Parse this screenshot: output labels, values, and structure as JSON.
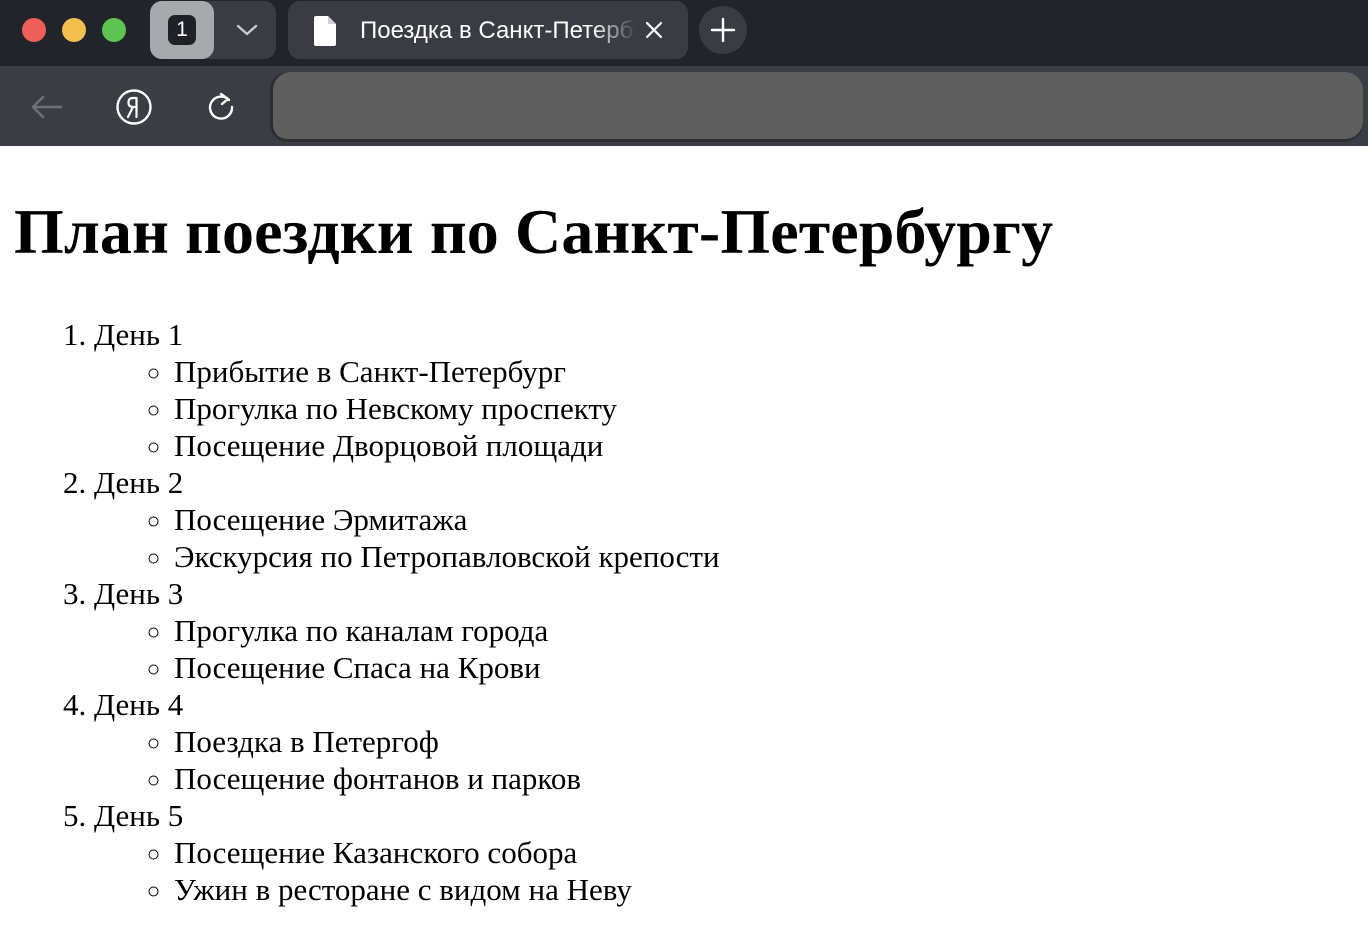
{
  "browser": {
    "tab_count": "1",
    "tab_title": "Поездка в Санкт-Петербург",
    "address": ""
  },
  "page": {
    "heading": "План поездки по Санкт-Петербургу",
    "days": [
      {
        "label": "День 1",
        "activities": [
          "Прибытие в Санкт-Петербург",
          "Прогулка по Невскому проспекту",
          "Посещение Дворцовой площади"
        ]
      },
      {
        "label": "День 2",
        "activities": [
          "Посещение Эрмитажа",
          "Экскурсия по Петропавловской крепости"
        ]
      },
      {
        "label": "День 3",
        "activities": [
          "Прогулка по каналам города",
          "Посещение Спаса на Крови"
        ]
      },
      {
        "label": "День 4",
        "activities": [
          "Поездка в Петергоф",
          "Посещение фонтанов и парков"
        ]
      },
      {
        "label": "День 5",
        "activities": [
          "Посещение Казанского собора",
          "Ужин в ресторане с видом на Неву"
        ]
      }
    ]
  },
  "icons": {
    "window_close": "traffic-light-red",
    "window_minimize": "traffic-light-yellow",
    "window_zoom": "traffic-light-green",
    "tabs_dropdown": "chevron-down-icon",
    "tab_document": "document-icon",
    "tab_close": "close-icon",
    "new_tab": "plus-icon",
    "back": "arrow-left-icon",
    "yandex": "yandex-logo-icon",
    "reload": "reload-icon"
  },
  "colors": {
    "titlebar": "#22242b",
    "toolbar": "#3b3d45",
    "tab": "#3a3c43",
    "address_bar": "#5f5f5f",
    "close": "#ee5f57",
    "minimize": "#f4bf4f",
    "zoom": "#5fc453"
  }
}
